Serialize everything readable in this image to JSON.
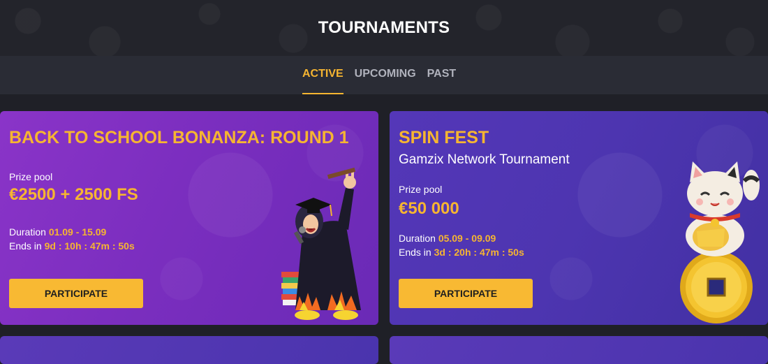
{
  "header": {
    "title": "TOURNAMENTS"
  },
  "tabs": [
    {
      "label": "ACTIVE",
      "active": true
    },
    {
      "label": "UPCOMING",
      "active": false
    },
    {
      "label": "PAST",
      "active": false
    }
  ],
  "tournaments": [
    {
      "title": "BACK TO SCHOOL BONANZA: ROUND 1",
      "subtitle": "",
      "prize_label": "Prize pool",
      "prize_value": "€2500 + 2500 FS",
      "duration_label": "Duration",
      "duration_value": "01.09 - 15.09",
      "ends_label": "Ends in",
      "ends_value": "9d : 10h : 47m : 50s",
      "button_label": "PARTICIPATE"
    },
    {
      "title": "SPIN FEST",
      "subtitle": "Gamzix Network Tournament",
      "prize_label": "Prize pool",
      "prize_value": "€50 000",
      "duration_label": "Duration",
      "duration_value": "05.09 - 09.09",
      "ends_label": "Ends in",
      "ends_value": "3d : 20h : 47m : 50s",
      "button_label": "PARTICIPATE"
    }
  ],
  "colors": {
    "accent": "#f6b531",
    "page_bg": "#1f2027",
    "card1_bg": "#8a34c8",
    "card2_bg": "#4d35b0"
  }
}
